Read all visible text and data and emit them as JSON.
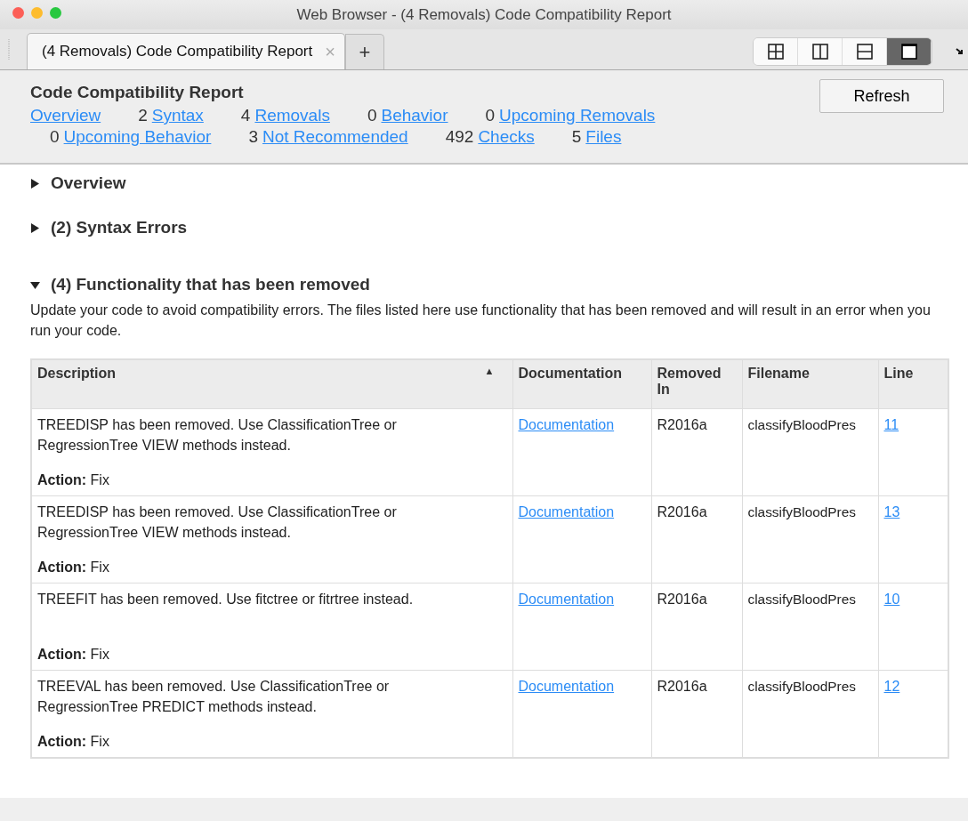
{
  "window": {
    "title": "Web Browser - (4 Removals) Code Compatibility Report"
  },
  "tabs": [
    {
      "label": "(4 Removals) Code Compatibility Report",
      "selected": true,
      "close": "×"
    }
  ],
  "new_tab": "+",
  "layout_buttons": [
    {
      "kind": "grid",
      "selected": false
    },
    {
      "kind": "columns",
      "selected": false
    },
    {
      "kind": "rows",
      "selected": false
    },
    {
      "kind": "single",
      "selected": true
    }
  ],
  "header": {
    "title": "Code Compatibility Report",
    "refresh": "Refresh",
    "links": [
      {
        "label": "Overview"
      },
      {
        "count": "2",
        "label": "Syntax"
      },
      {
        "count": "4",
        "label": "Removals"
      },
      {
        "count": "0",
        "label": "Behavior"
      },
      {
        "count": "0",
        "label": "Upcoming Removals"
      },
      {
        "count": "0",
        "label": "Upcoming Behavior"
      },
      {
        "count": "3",
        "label": "Not Recommended"
      },
      {
        "count": "492",
        "label": "Checks"
      },
      {
        "count": "5",
        "label": "Files"
      }
    ]
  },
  "sections": [
    {
      "title": "Overview",
      "expanded": false
    },
    {
      "title": "(2) Syntax Errors",
      "expanded": false
    },
    {
      "title": "(4) Functionality that has been removed",
      "expanded": true,
      "description": "Update your code to avoid compatibility errors. The files listed here use functionality that has been removed and will result in an error when you run your code.",
      "table": {
        "columns": [
          {
            "label": "Description",
            "sort": "▲"
          },
          {
            "label": "Documentation"
          },
          {
            "label": "Removed In"
          },
          {
            "label": "Filename"
          },
          {
            "label": "Line"
          }
        ],
        "rows": [
          {
            "description": "TREEDISP has been removed. Use ClassificationTree or RegressionTree VIEW methods instead.",
            "action_label": "Action:",
            "action": "Fix",
            "documentation": "Documentation",
            "removed_in": "R2016a",
            "filename": "classifyBloodPres",
            "line": "11"
          },
          {
            "description": "TREEDISP has been removed. Use ClassificationTree or RegressionTree VIEW methods instead.",
            "action_label": "Action:",
            "action": "Fix",
            "documentation": "Documentation",
            "removed_in": "R2016a",
            "filename": "classifyBloodPres",
            "line": "13"
          },
          {
            "description": "TREEFIT has been removed. Use fitctree or fitrtree instead.",
            "action_label": "Action:",
            "action": "Fix",
            "documentation": "Documentation",
            "removed_in": "R2016a",
            "filename": "classifyBloodPres",
            "line": "10"
          },
          {
            "description": "TREEVAL has been removed. Use ClassificationTree or RegressionTree PREDICT methods instead.",
            "action_label": "Action:",
            "action": "Fix",
            "documentation": "Documentation",
            "removed_in": "R2016a",
            "filename": "classifyBloodPres",
            "line": "12"
          }
        ]
      }
    }
  ]
}
